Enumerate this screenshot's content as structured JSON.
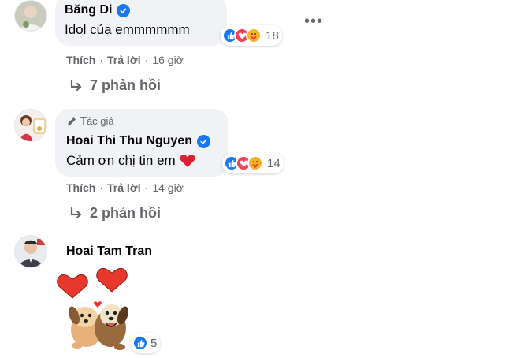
{
  "comments": [
    {
      "author": "Băng Di",
      "text": "Idol của emmmmmm",
      "reaction_count": "18",
      "actions": {
        "like": "Thích",
        "reply": "Trả lời",
        "time": "16 giờ"
      },
      "replies": "7 phản hồi",
      "verified": true
    },
    {
      "author_badge": "Tác giả",
      "author": "Hoai Thi Thu Nguyen",
      "text": "Cảm ơn chị tin em",
      "reaction_count": "14",
      "actions": {
        "like": "Thích",
        "reply": "Trả lời",
        "time": "14 giờ"
      },
      "replies": "2 phản hồi",
      "verified": true
    },
    {
      "author": "Hoai Tam Tran",
      "reaction_count": "5",
      "sticker": "dogs-with-hearts-sticker"
    }
  ],
  "colors": {
    "facebook_blue": "#1877f2",
    "love_red": "#f33e58",
    "care_yellow": "#f7b125",
    "bubble_bg": "#f0f2f5",
    "meta_text": "#65676b"
  }
}
